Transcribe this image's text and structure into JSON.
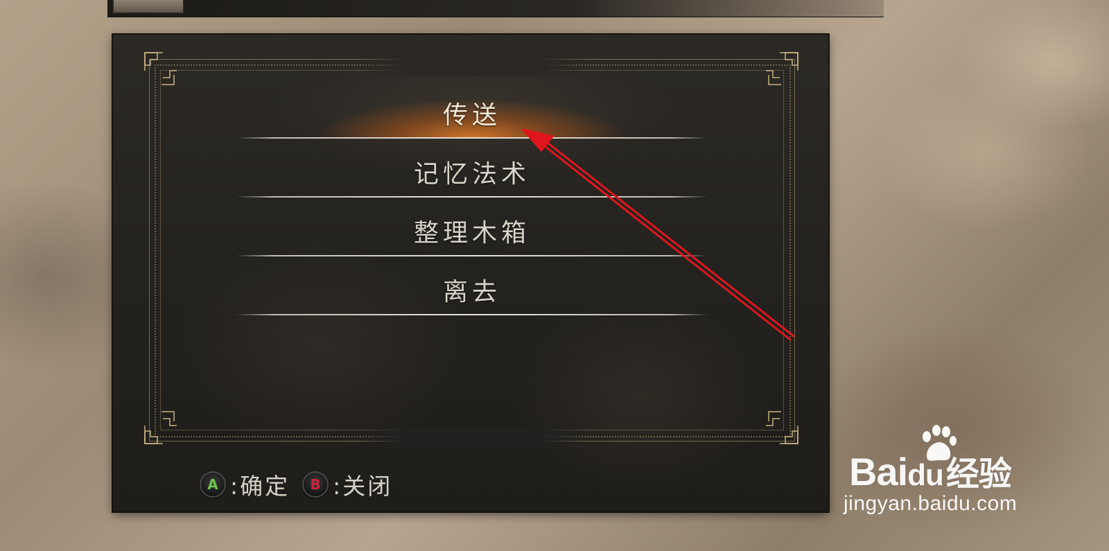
{
  "menu": {
    "items": [
      {
        "label": "传送",
        "selected": true
      },
      {
        "label": "记忆法术",
        "selected": false
      },
      {
        "label": "整理木箱",
        "selected": false
      },
      {
        "label": "离去",
        "selected": false
      }
    ]
  },
  "hints": {
    "confirm_key": "A",
    "confirm_label": ":确定",
    "close_key": "B",
    "close_label": ":关闭"
  },
  "watermark": {
    "brand_prefix": "Bai",
    "brand_mid": "du",
    "brand_suffix": "经验",
    "url": "jingyan.baidu.com"
  },
  "colors": {
    "selection_glow": "#d6782a",
    "annotation_arrow": "#e0161c",
    "button_a": "#6cc24a",
    "button_b": "#c9233b"
  }
}
